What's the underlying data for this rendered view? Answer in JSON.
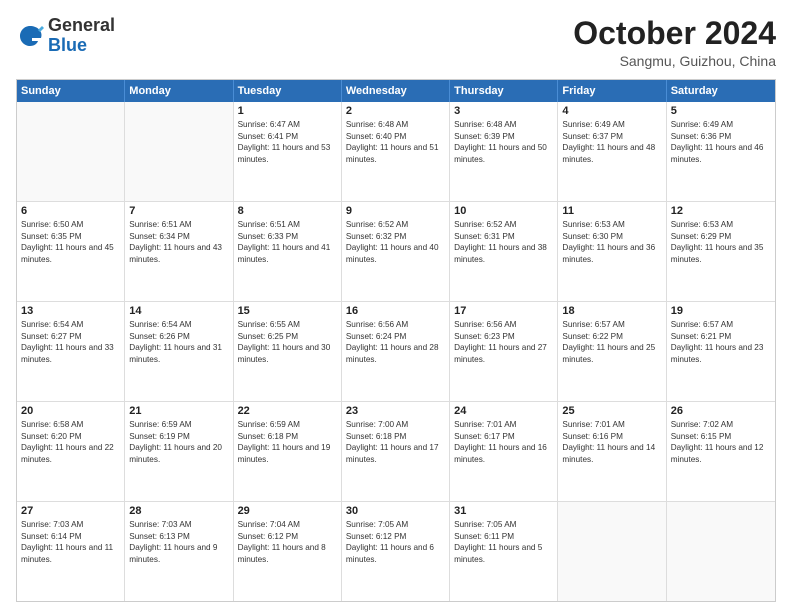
{
  "header": {
    "logo_general": "General",
    "logo_blue": "Blue",
    "month_title": "October 2024",
    "location": "Sangmu, Guizhou, China"
  },
  "calendar": {
    "days_of_week": [
      "Sunday",
      "Monday",
      "Tuesday",
      "Wednesday",
      "Thursday",
      "Friday",
      "Saturday"
    ],
    "rows": [
      [
        {
          "day": "",
          "sunrise": "",
          "sunset": "",
          "daylight": "",
          "empty": true
        },
        {
          "day": "",
          "sunrise": "",
          "sunset": "",
          "daylight": "",
          "empty": true
        },
        {
          "day": "1",
          "sunrise": "Sunrise: 6:47 AM",
          "sunset": "Sunset: 6:41 PM",
          "daylight": "Daylight: 11 hours and 53 minutes."
        },
        {
          "day": "2",
          "sunrise": "Sunrise: 6:48 AM",
          "sunset": "Sunset: 6:40 PM",
          "daylight": "Daylight: 11 hours and 51 minutes."
        },
        {
          "day": "3",
          "sunrise": "Sunrise: 6:48 AM",
          "sunset": "Sunset: 6:39 PM",
          "daylight": "Daylight: 11 hours and 50 minutes."
        },
        {
          "day": "4",
          "sunrise": "Sunrise: 6:49 AM",
          "sunset": "Sunset: 6:37 PM",
          "daylight": "Daylight: 11 hours and 48 minutes."
        },
        {
          "day": "5",
          "sunrise": "Sunrise: 6:49 AM",
          "sunset": "Sunset: 6:36 PM",
          "daylight": "Daylight: 11 hours and 46 minutes."
        }
      ],
      [
        {
          "day": "6",
          "sunrise": "Sunrise: 6:50 AM",
          "sunset": "Sunset: 6:35 PM",
          "daylight": "Daylight: 11 hours and 45 minutes."
        },
        {
          "day": "7",
          "sunrise": "Sunrise: 6:51 AM",
          "sunset": "Sunset: 6:34 PM",
          "daylight": "Daylight: 11 hours and 43 minutes."
        },
        {
          "day": "8",
          "sunrise": "Sunrise: 6:51 AM",
          "sunset": "Sunset: 6:33 PM",
          "daylight": "Daylight: 11 hours and 41 minutes."
        },
        {
          "day": "9",
          "sunrise": "Sunrise: 6:52 AM",
          "sunset": "Sunset: 6:32 PM",
          "daylight": "Daylight: 11 hours and 40 minutes."
        },
        {
          "day": "10",
          "sunrise": "Sunrise: 6:52 AM",
          "sunset": "Sunset: 6:31 PM",
          "daylight": "Daylight: 11 hours and 38 minutes."
        },
        {
          "day": "11",
          "sunrise": "Sunrise: 6:53 AM",
          "sunset": "Sunset: 6:30 PM",
          "daylight": "Daylight: 11 hours and 36 minutes."
        },
        {
          "day": "12",
          "sunrise": "Sunrise: 6:53 AM",
          "sunset": "Sunset: 6:29 PM",
          "daylight": "Daylight: 11 hours and 35 minutes."
        }
      ],
      [
        {
          "day": "13",
          "sunrise": "Sunrise: 6:54 AM",
          "sunset": "Sunset: 6:27 PM",
          "daylight": "Daylight: 11 hours and 33 minutes."
        },
        {
          "day": "14",
          "sunrise": "Sunrise: 6:54 AM",
          "sunset": "Sunset: 6:26 PM",
          "daylight": "Daylight: 11 hours and 31 minutes."
        },
        {
          "day": "15",
          "sunrise": "Sunrise: 6:55 AM",
          "sunset": "Sunset: 6:25 PM",
          "daylight": "Daylight: 11 hours and 30 minutes."
        },
        {
          "day": "16",
          "sunrise": "Sunrise: 6:56 AM",
          "sunset": "Sunset: 6:24 PM",
          "daylight": "Daylight: 11 hours and 28 minutes."
        },
        {
          "day": "17",
          "sunrise": "Sunrise: 6:56 AM",
          "sunset": "Sunset: 6:23 PM",
          "daylight": "Daylight: 11 hours and 27 minutes."
        },
        {
          "day": "18",
          "sunrise": "Sunrise: 6:57 AM",
          "sunset": "Sunset: 6:22 PM",
          "daylight": "Daylight: 11 hours and 25 minutes."
        },
        {
          "day": "19",
          "sunrise": "Sunrise: 6:57 AM",
          "sunset": "Sunset: 6:21 PM",
          "daylight": "Daylight: 11 hours and 23 minutes."
        }
      ],
      [
        {
          "day": "20",
          "sunrise": "Sunrise: 6:58 AM",
          "sunset": "Sunset: 6:20 PM",
          "daylight": "Daylight: 11 hours and 22 minutes."
        },
        {
          "day": "21",
          "sunrise": "Sunrise: 6:59 AM",
          "sunset": "Sunset: 6:19 PM",
          "daylight": "Daylight: 11 hours and 20 minutes."
        },
        {
          "day": "22",
          "sunrise": "Sunrise: 6:59 AM",
          "sunset": "Sunset: 6:18 PM",
          "daylight": "Daylight: 11 hours and 19 minutes."
        },
        {
          "day": "23",
          "sunrise": "Sunrise: 7:00 AM",
          "sunset": "Sunset: 6:18 PM",
          "daylight": "Daylight: 11 hours and 17 minutes."
        },
        {
          "day": "24",
          "sunrise": "Sunrise: 7:01 AM",
          "sunset": "Sunset: 6:17 PM",
          "daylight": "Daylight: 11 hours and 16 minutes."
        },
        {
          "day": "25",
          "sunrise": "Sunrise: 7:01 AM",
          "sunset": "Sunset: 6:16 PM",
          "daylight": "Daylight: 11 hours and 14 minutes."
        },
        {
          "day": "26",
          "sunrise": "Sunrise: 7:02 AM",
          "sunset": "Sunset: 6:15 PM",
          "daylight": "Daylight: 11 hours and 12 minutes."
        }
      ],
      [
        {
          "day": "27",
          "sunrise": "Sunrise: 7:03 AM",
          "sunset": "Sunset: 6:14 PM",
          "daylight": "Daylight: 11 hours and 11 minutes."
        },
        {
          "day": "28",
          "sunrise": "Sunrise: 7:03 AM",
          "sunset": "Sunset: 6:13 PM",
          "daylight": "Daylight: 11 hours and 9 minutes."
        },
        {
          "day": "29",
          "sunrise": "Sunrise: 7:04 AM",
          "sunset": "Sunset: 6:12 PM",
          "daylight": "Daylight: 11 hours and 8 minutes."
        },
        {
          "day": "30",
          "sunrise": "Sunrise: 7:05 AM",
          "sunset": "Sunset: 6:12 PM",
          "daylight": "Daylight: 11 hours and 6 minutes."
        },
        {
          "day": "31",
          "sunrise": "Sunrise: 7:05 AM",
          "sunset": "Sunset: 6:11 PM",
          "daylight": "Daylight: 11 hours and 5 minutes."
        },
        {
          "day": "",
          "sunrise": "",
          "sunset": "",
          "daylight": "",
          "empty": true
        },
        {
          "day": "",
          "sunrise": "",
          "sunset": "",
          "daylight": "",
          "empty": true
        }
      ]
    ]
  }
}
